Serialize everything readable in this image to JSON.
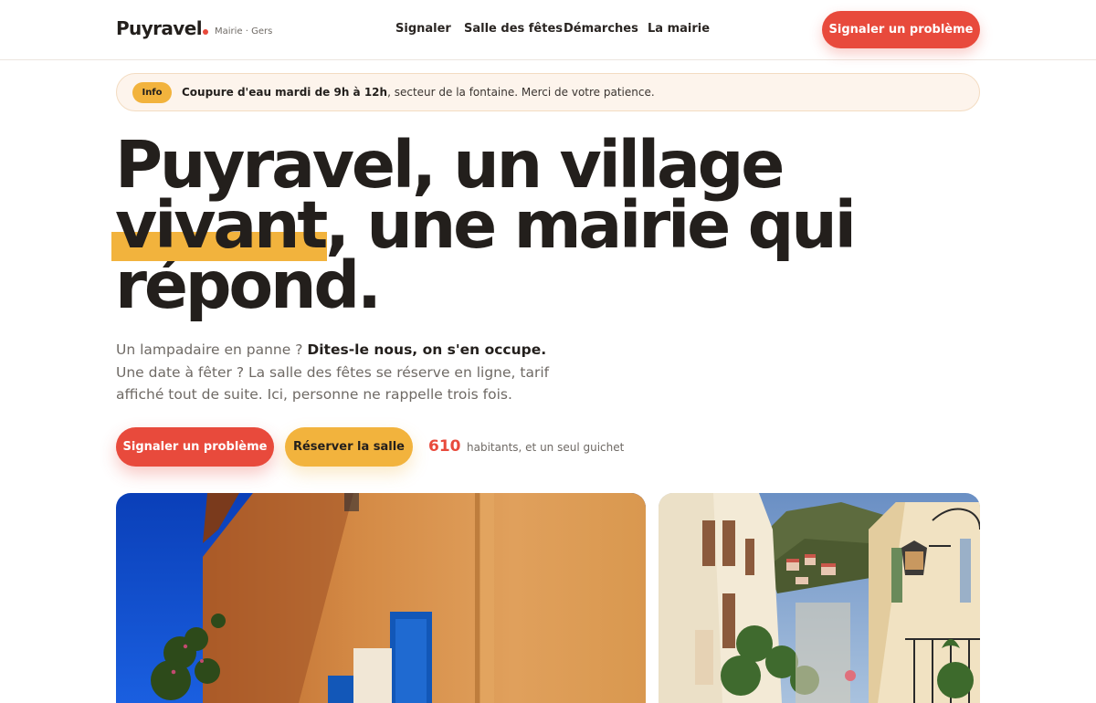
{
  "brand": {
    "name": "Puyravel",
    "subtitle": "Mairie · Gers"
  },
  "nav": [
    {
      "label": "Signaler"
    },
    {
      "label": "Salle des fêtes"
    },
    {
      "label": "Démarches"
    },
    {
      "label": "La mairie"
    }
  ],
  "header_cta": "Signaler un problème",
  "banner": {
    "badge": "Info",
    "bold": "Coupure d'eau mardi de 9h à 12h",
    "rest": ", secteur de la fontaine. Merci de votre patience."
  },
  "hero": {
    "line1": "Puyravel, un village",
    "highlight": "vivant",
    "line2_rest": ", une mairie qui",
    "line3": "répond.",
    "lead_start": "Un lampadaire en panne ? ",
    "lead_bold": "Dites-le nous, on s'en occupe.",
    "lead_end": " Une date à fêter ? La salle des fêtes se réserve en ligne, tarif affiché tout de suite. Ici, personne ne rappelle trois fois."
  },
  "cta": {
    "primary": "Signaler un problème",
    "secondary": "Réserver la salle"
  },
  "stat": {
    "value": "610",
    "label": "habitants, et un seul guichet"
  },
  "colors": {
    "accent_red": "#e84a3c",
    "accent_yellow": "#f2b33d",
    "ink": "#231f1c",
    "muted": "#6f6a65",
    "banner_bg": "#fdf4ec"
  }
}
